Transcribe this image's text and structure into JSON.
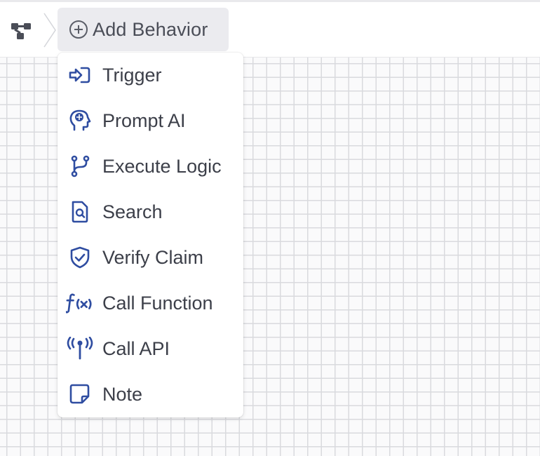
{
  "toolbar": {
    "workflow_icon": "workflow-tree-icon",
    "add_behavior_label": "Add Behavior",
    "add_behavior_icon": "plus-circle-icon"
  },
  "menu": {
    "accent_color": "#2f4da1",
    "items": [
      {
        "label": "Trigger",
        "icon": "trigger-icon"
      },
      {
        "label": "Prompt AI",
        "icon": "ai-head-icon"
      },
      {
        "label": "Execute Logic",
        "icon": "branch-icon"
      },
      {
        "label": "Search",
        "icon": "search-document-icon"
      },
      {
        "label": "Verify Claim",
        "icon": "shield-check-icon"
      },
      {
        "label": "Call Function",
        "icon": "function-icon"
      },
      {
        "label": "Call API",
        "icon": "antenna-icon"
      },
      {
        "label": "Note",
        "icon": "note-icon"
      }
    ]
  }
}
